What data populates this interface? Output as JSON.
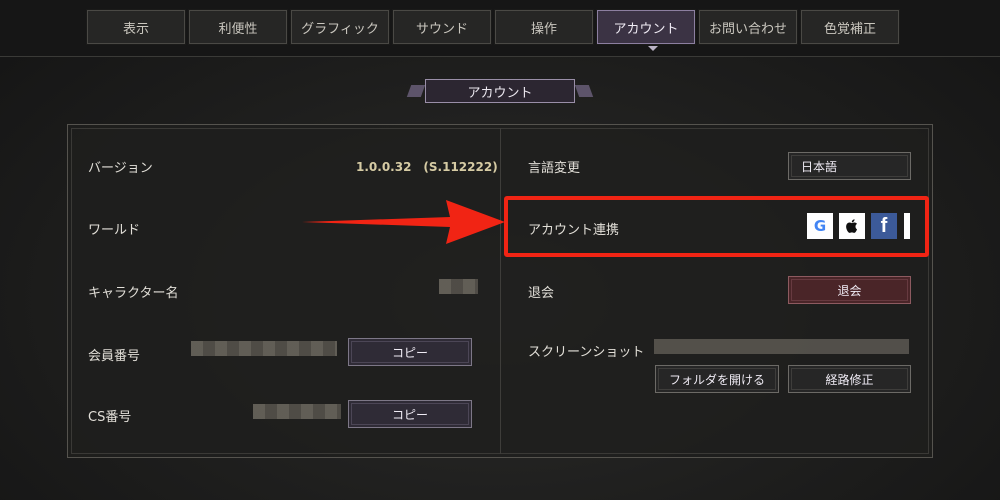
{
  "tabs": [
    "表示",
    "利便性",
    "グラフィック",
    "サウンド",
    "操作",
    "アカウント",
    "お問い合わせ",
    "色覚補正"
  ],
  "active_tab": "アカウント",
  "section_title": "アカウント",
  "left": {
    "version_label": "バージョン",
    "version_value": "1.0.0.32　(S.112222)",
    "world_label": "ワールド",
    "character_label": "キャラクター名",
    "member_label": "会員番号",
    "member_copy": "コピー",
    "cs_label": "CS番号",
    "cs_copy": "コピー"
  },
  "right": {
    "language_label": "言語変更",
    "language_value": "日本語",
    "link_label": "アカウント連携",
    "withdraw_label": "退会",
    "withdraw_button": "退会",
    "screenshot_label": "スクリーンショット",
    "open_folder": "フォルダを開ける",
    "fix_path": "経路修正"
  },
  "sns": {
    "google": "G",
    "apple": "",
    "facebook": "f"
  },
  "colors": {
    "highlight": "#f12414",
    "active_tab": "#3b3344",
    "accent": "#8c7fa0"
  }
}
